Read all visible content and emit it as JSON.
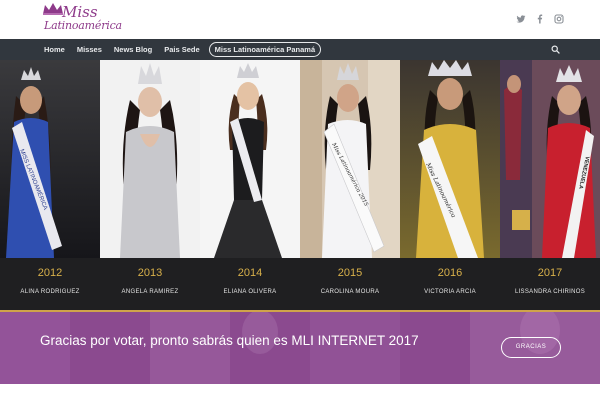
{
  "header": {
    "logo_line1": "Miss",
    "logo_line2": "Latinoamérica",
    "social_icons": [
      "twitter-icon",
      "facebook-icon",
      "instagram-icon"
    ]
  },
  "nav": {
    "items": [
      {
        "label": "Home"
      },
      {
        "label": "Misses"
      },
      {
        "label": "News Blog"
      },
      {
        "label": "Pais Sede"
      },
      {
        "label": "Miss Latinoamérica Panamá"
      }
    ],
    "search_icon": "search-icon"
  },
  "winners": [
    {
      "year": "2012",
      "name": "ALINA RODRIGUEZ",
      "sash": "MISS LATINOAMÉRICA"
    },
    {
      "year": "2013",
      "name": "ANGELA RAMIREZ",
      "sash": ""
    },
    {
      "year": "2014",
      "name": "ELIANA OLIVERA",
      "sash": ""
    },
    {
      "year": "2015",
      "name": "CAROLINA MOURA",
      "sash": "Miss Latinoamérica 2015"
    },
    {
      "year": "2016",
      "name": "VICTORIA ARCIA",
      "sash": "Miss Latinoamérica"
    },
    {
      "year": "2017",
      "name": "LISSANDRA CHIRINOS",
      "sash": "VENEZUELA"
    }
  ],
  "cta": {
    "message": "Gracias por votar, pronto sabrás quien es MLI INTERNET 2017",
    "button_label": "GRACIAS"
  },
  "colors": {
    "nav_bg": "#31373e",
    "year_gold": "#d8b04a",
    "cta_purple": "#8b4a8f",
    "logo_purple": "#8e3a8a"
  }
}
